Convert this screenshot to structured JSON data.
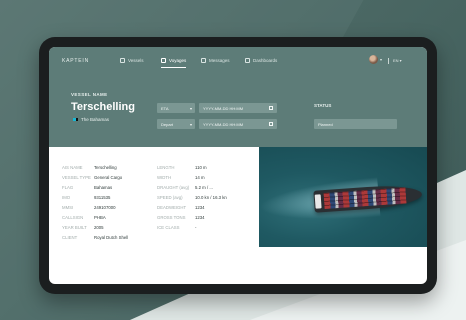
{
  "nav": {
    "brand": "KAPTEIN",
    "items": [
      {
        "label": "Vessels",
        "icon": "ship-icon"
      },
      {
        "label": "Voyages",
        "icon": "route-icon"
      },
      {
        "label": "Messages",
        "icon": "message-icon"
      },
      {
        "label": "Dashboards",
        "icon": "chart-icon"
      }
    ],
    "active_index": 1,
    "language": "EN"
  },
  "vessel": {
    "name_label": "VESSEL NAME",
    "name": "Terschelling",
    "flag": "The Bahamas"
  },
  "filters": {
    "eta_select": "ETA",
    "eta_datetime": "YYYY-MM-DD  HH:MM",
    "departure_select": "Depart",
    "departure_datetime": "YYYY-MM-DD  HH:MM"
  },
  "status": {
    "label": "STATUS",
    "value": "Planned"
  },
  "details_left": [
    {
      "label": "AIS NAME",
      "value": "Terschelling"
    },
    {
      "label": "VESSEL TYPE",
      "value": "General Cargo"
    },
    {
      "label": "FLAG",
      "value": "Bahamas"
    },
    {
      "label": "IMO",
      "value": "9311535"
    },
    {
      "label": "MMSI",
      "value": "249107000"
    },
    {
      "label": "CALLSIGN",
      "value": "PHBA"
    },
    {
      "label": "YEAR BUILT",
      "value": "2005"
    },
    {
      "label": "CLIENT",
      "value": "Royal Dutch Shell"
    }
  ],
  "details_right": [
    {
      "label": "LENGTH",
      "value": "110 m"
    },
    {
      "label": "WIDTH",
      "value": "14 m"
    },
    {
      "label": "DRAUGHT (avg)",
      "value": "5.2 m / ..."
    },
    {
      "label": "SPEED (avg)",
      "value": "10.0 kn / 16.3 kn"
    },
    {
      "label": "DEADWEIGHT",
      "value": "1234"
    },
    {
      "label": "GROSS TONS",
      "value": "1234"
    },
    {
      "label": "ICE CLASS",
      "value": "-"
    }
  ]
}
